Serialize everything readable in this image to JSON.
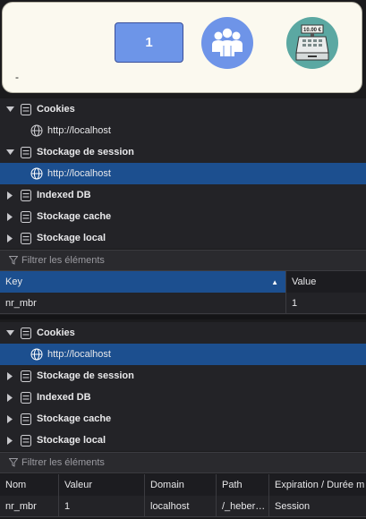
{
  "app": {
    "counter": "1",
    "register_amount": "10.00 €",
    "footer_text": "-"
  },
  "storage_tree_1": {
    "items": [
      {
        "label": "Cookies",
        "expanded": true
      },
      {
        "label": "http://localhost"
      },
      {
        "label": "Stockage de session",
        "expanded": true
      },
      {
        "label": "http://localhost"
      },
      {
        "label": "Indexed DB",
        "expanded": false
      },
      {
        "label": "Stockage cache",
        "expanded": false
      },
      {
        "label": "Stockage local",
        "expanded": false
      }
    ]
  },
  "filter_1": {
    "placeholder": "Filtrer les éléments"
  },
  "session_table": {
    "columns": [
      "Key",
      "Value"
    ],
    "rows": [
      [
        "nr_mbr",
        "1"
      ]
    ]
  },
  "storage_tree_2": {
    "items": [
      {
        "label": "Cookies",
        "expanded": true
      },
      {
        "label": "http://localhost"
      },
      {
        "label": "Stockage de session",
        "expanded": false
      },
      {
        "label": "Indexed DB",
        "expanded": false
      },
      {
        "label": "Stockage cache",
        "expanded": false
      },
      {
        "label": "Stockage local",
        "expanded": false
      }
    ]
  },
  "filter_2": {
    "placeholder": "Filtrer les éléments"
  },
  "cookie_table": {
    "columns": [
      "Nom",
      "Valeur",
      "Domain",
      "Path",
      "Expiration / Durée m"
    ],
    "rows": [
      [
        "nr_mbr",
        "1",
        "localhost",
        "/_heber…",
        "Session"
      ]
    ]
  },
  "colors": {
    "selection": "#1c4f8f",
    "panel_bg": "#232327",
    "accent_blue": "#6d95e8",
    "accent_teal": "#5ba8a2"
  }
}
